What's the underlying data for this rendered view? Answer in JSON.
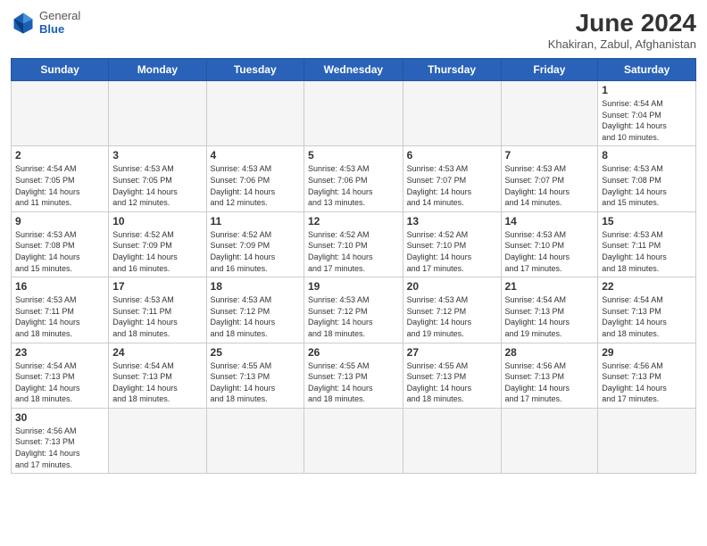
{
  "header": {
    "logo_general": "General",
    "logo_blue": "Blue",
    "title": "June 2024",
    "subtitle": "Khakiran, Zabul, Afghanistan"
  },
  "weekdays": [
    "Sunday",
    "Monday",
    "Tuesday",
    "Wednesday",
    "Thursday",
    "Friday",
    "Saturday"
  ],
  "weeks": [
    [
      {
        "day": "",
        "info": ""
      },
      {
        "day": "",
        "info": ""
      },
      {
        "day": "",
        "info": ""
      },
      {
        "day": "",
        "info": ""
      },
      {
        "day": "",
        "info": ""
      },
      {
        "day": "",
        "info": ""
      },
      {
        "day": "1",
        "info": "Sunrise: 4:54 AM\nSunset: 7:04 PM\nDaylight: 14 hours\nand 10 minutes."
      }
    ],
    [
      {
        "day": "2",
        "info": "Sunrise: 4:54 AM\nSunset: 7:05 PM\nDaylight: 14 hours\nand 11 minutes."
      },
      {
        "day": "3",
        "info": "Sunrise: 4:53 AM\nSunset: 7:05 PM\nDaylight: 14 hours\nand 12 minutes."
      },
      {
        "day": "4",
        "info": "Sunrise: 4:53 AM\nSunset: 7:06 PM\nDaylight: 14 hours\nand 12 minutes."
      },
      {
        "day": "5",
        "info": "Sunrise: 4:53 AM\nSunset: 7:06 PM\nDaylight: 14 hours\nand 13 minutes."
      },
      {
        "day": "6",
        "info": "Sunrise: 4:53 AM\nSunset: 7:07 PM\nDaylight: 14 hours\nand 14 minutes."
      },
      {
        "day": "7",
        "info": "Sunrise: 4:53 AM\nSunset: 7:07 PM\nDaylight: 14 hours\nand 14 minutes."
      },
      {
        "day": "8",
        "info": "Sunrise: 4:53 AM\nSunset: 7:08 PM\nDaylight: 14 hours\nand 15 minutes."
      }
    ],
    [
      {
        "day": "9",
        "info": "Sunrise: 4:53 AM\nSunset: 7:08 PM\nDaylight: 14 hours\nand 15 minutes."
      },
      {
        "day": "10",
        "info": "Sunrise: 4:52 AM\nSunset: 7:09 PM\nDaylight: 14 hours\nand 16 minutes."
      },
      {
        "day": "11",
        "info": "Sunrise: 4:52 AM\nSunset: 7:09 PM\nDaylight: 14 hours\nand 16 minutes."
      },
      {
        "day": "12",
        "info": "Sunrise: 4:52 AM\nSunset: 7:10 PM\nDaylight: 14 hours\nand 17 minutes."
      },
      {
        "day": "13",
        "info": "Sunrise: 4:52 AM\nSunset: 7:10 PM\nDaylight: 14 hours\nand 17 minutes."
      },
      {
        "day": "14",
        "info": "Sunrise: 4:53 AM\nSunset: 7:10 PM\nDaylight: 14 hours\nand 17 minutes."
      },
      {
        "day": "15",
        "info": "Sunrise: 4:53 AM\nSunset: 7:11 PM\nDaylight: 14 hours\nand 18 minutes."
      }
    ],
    [
      {
        "day": "16",
        "info": "Sunrise: 4:53 AM\nSunset: 7:11 PM\nDaylight: 14 hours\nand 18 minutes."
      },
      {
        "day": "17",
        "info": "Sunrise: 4:53 AM\nSunset: 7:11 PM\nDaylight: 14 hours\nand 18 minutes."
      },
      {
        "day": "18",
        "info": "Sunrise: 4:53 AM\nSunset: 7:12 PM\nDaylight: 14 hours\nand 18 minutes."
      },
      {
        "day": "19",
        "info": "Sunrise: 4:53 AM\nSunset: 7:12 PM\nDaylight: 14 hours\nand 18 minutes."
      },
      {
        "day": "20",
        "info": "Sunrise: 4:53 AM\nSunset: 7:12 PM\nDaylight: 14 hours\nand 19 minutes."
      },
      {
        "day": "21",
        "info": "Sunrise: 4:54 AM\nSunset: 7:13 PM\nDaylight: 14 hours\nand 19 minutes."
      },
      {
        "day": "22",
        "info": "Sunrise: 4:54 AM\nSunset: 7:13 PM\nDaylight: 14 hours\nand 18 minutes."
      }
    ],
    [
      {
        "day": "23",
        "info": "Sunrise: 4:54 AM\nSunset: 7:13 PM\nDaylight: 14 hours\nand 18 minutes."
      },
      {
        "day": "24",
        "info": "Sunrise: 4:54 AM\nSunset: 7:13 PM\nDaylight: 14 hours\nand 18 minutes."
      },
      {
        "day": "25",
        "info": "Sunrise: 4:55 AM\nSunset: 7:13 PM\nDaylight: 14 hours\nand 18 minutes."
      },
      {
        "day": "26",
        "info": "Sunrise: 4:55 AM\nSunset: 7:13 PM\nDaylight: 14 hours\nand 18 minutes."
      },
      {
        "day": "27",
        "info": "Sunrise: 4:55 AM\nSunset: 7:13 PM\nDaylight: 14 hours\nand 18 minutes."
      },
      {
        "day": "28",
        "info": "Sunrise: 4:56 AM\nSunset: 7:13 PM\nDaylight: 14 hours\nand 17 minutes."
      },
      {
        "day": "29",
        "info": "Sunrise: 4:56 AM\nSunset: 7:13 PM\nDaylight: 14 hours\nand 17 minutes."
      }
    ],
    [
      {
        "day": "30",
        "info": "Sunrise: 4:56 AM\nSunset: 7:13 PM\nDaylight: 14 hours\nand 17 minutes."
      },
      {
        "day": "",
        "info": ""
      },
      {
        "day": "",
        "info": ""
      },
      {
        "day": "",
        "info": ""
      },
      {
        "day": "",
        "info": ""
      },
      {
        "day": "",
        "info": ""
      },
      {
        "day": "",
        "info": ""
      }
    ]
  ]
}
